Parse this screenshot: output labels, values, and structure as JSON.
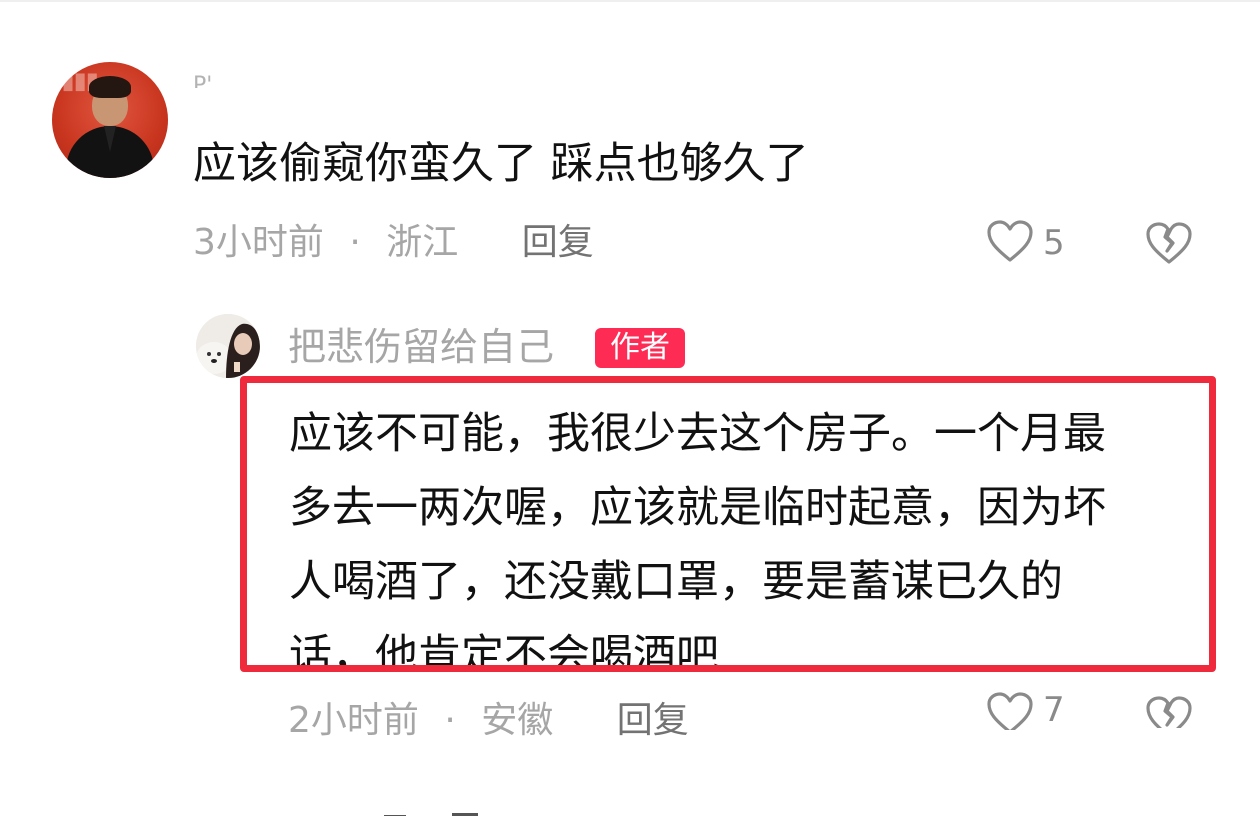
{
  "comment": {
    "username": "P'",
    "text": "应该偷窥你蛮久了 踩点也够久了",
    "time": "3小时前",
    "separator": "·",
    "location": "浙江",
    "reply_label": "回复",
    "like_count": "5",
    "like_icon": "heart-outline-icon",
    "dislike_icon": "broken-heart-icon"
  },
  "reply": {
    "username": "把悲伤留给自己",
    "badge": "作者",
    "lines": [
      "应该不可能，我很少去这个房子。一个月最",
      "多去一两次喔，应该就是临时起意，因为坏",
      "人喝酒了，还没戴口罩，要是蓄谋已久的",
      "话，他肯定不会喝酒吧"
    ],
    "time": "2小时前",
    "separator": "·",
    "location": "安徽",
    "reply_label": "回复",
    "like_count": "7"
  },
  "colors": {
    "badge": "#fe2c55",
    "highlight_border": "#ee2a3c",
    "text": "#111111",
    "meta": "#a6a6a6"
  }
}
